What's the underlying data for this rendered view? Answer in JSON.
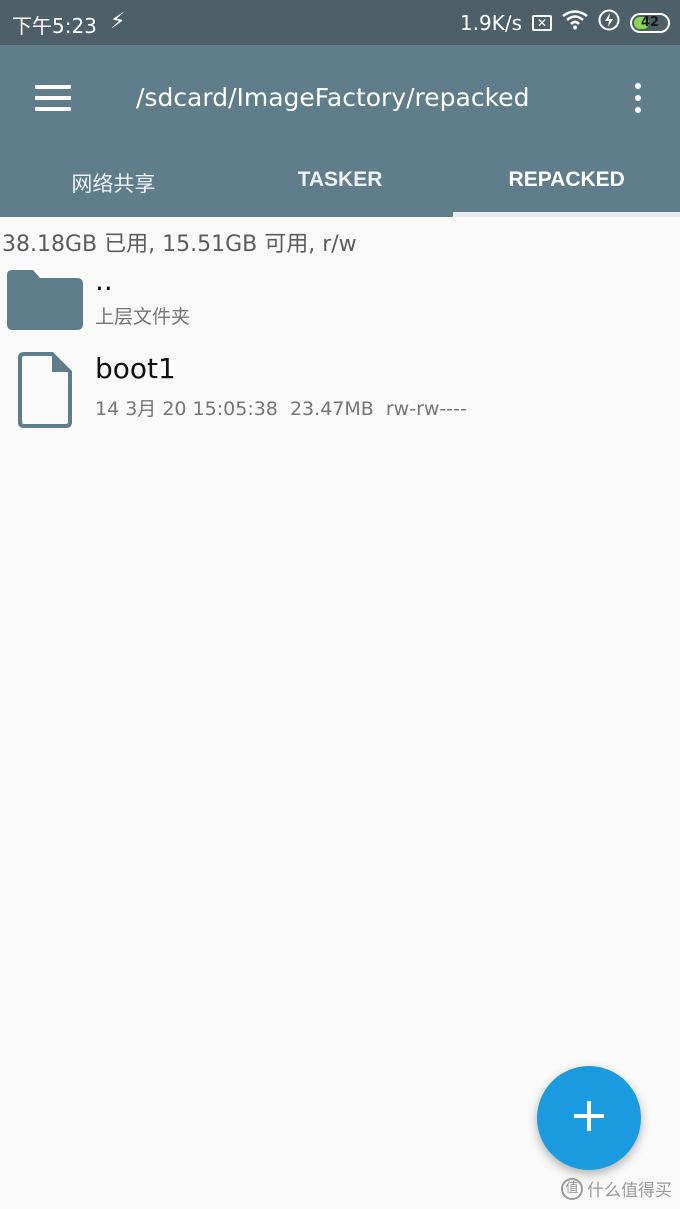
{
  "status_bar": {
    "time": "下午5:23",
    "network_speed": "1.9K/s",
    "battery_level": "42",
    "battery_fraction": 0.42,
    "icons": [
      "flash-icon",
      "no-sim-icon",
      "wifi-icon",
      "charging-icon",
      "battery-icon"
    ]
  },
  "toolbar": {
    "path": "/sdcard/ImageFactory/repacked",
    "menu_icon": "hamburger-menu-icon",
    "overflow_icon": "more-vert-icon"
  },
  "tabs": [
    {
      "label": "网络共享",
      "active": false
    },
    {
      "label": "TASKER",
      "active": false
    },
    {
      "label": "REPACKED",
      "active": true
    }
  ],
  "storage": {
    "info": "38.18GB 已用, 15.51GB 可用, r/w"
  },
  "files": [
    {
      "name": "..",
      "detail": "上层文件夹",
      "icon": "folder-icon"
    },
    {
      "name": "boot1",
      "detail": "14 3月 20 15:05:38  23.47MB  rw-rw----",
      "icon": "file-icon"
    }
  ],
  "fab": {
    "icon": "plus-icon"
  },
  "watermark": {
    "logo": "值",
    "text": "什么值得买"
  },
  "colors": {
    "status_bar": "#4d5f69",
    "app_bar": "#607d8b",
    "fab": "#1a9bdf",
    "icon": "#607d8b",
    "background": "#fafafa"
  }
}
